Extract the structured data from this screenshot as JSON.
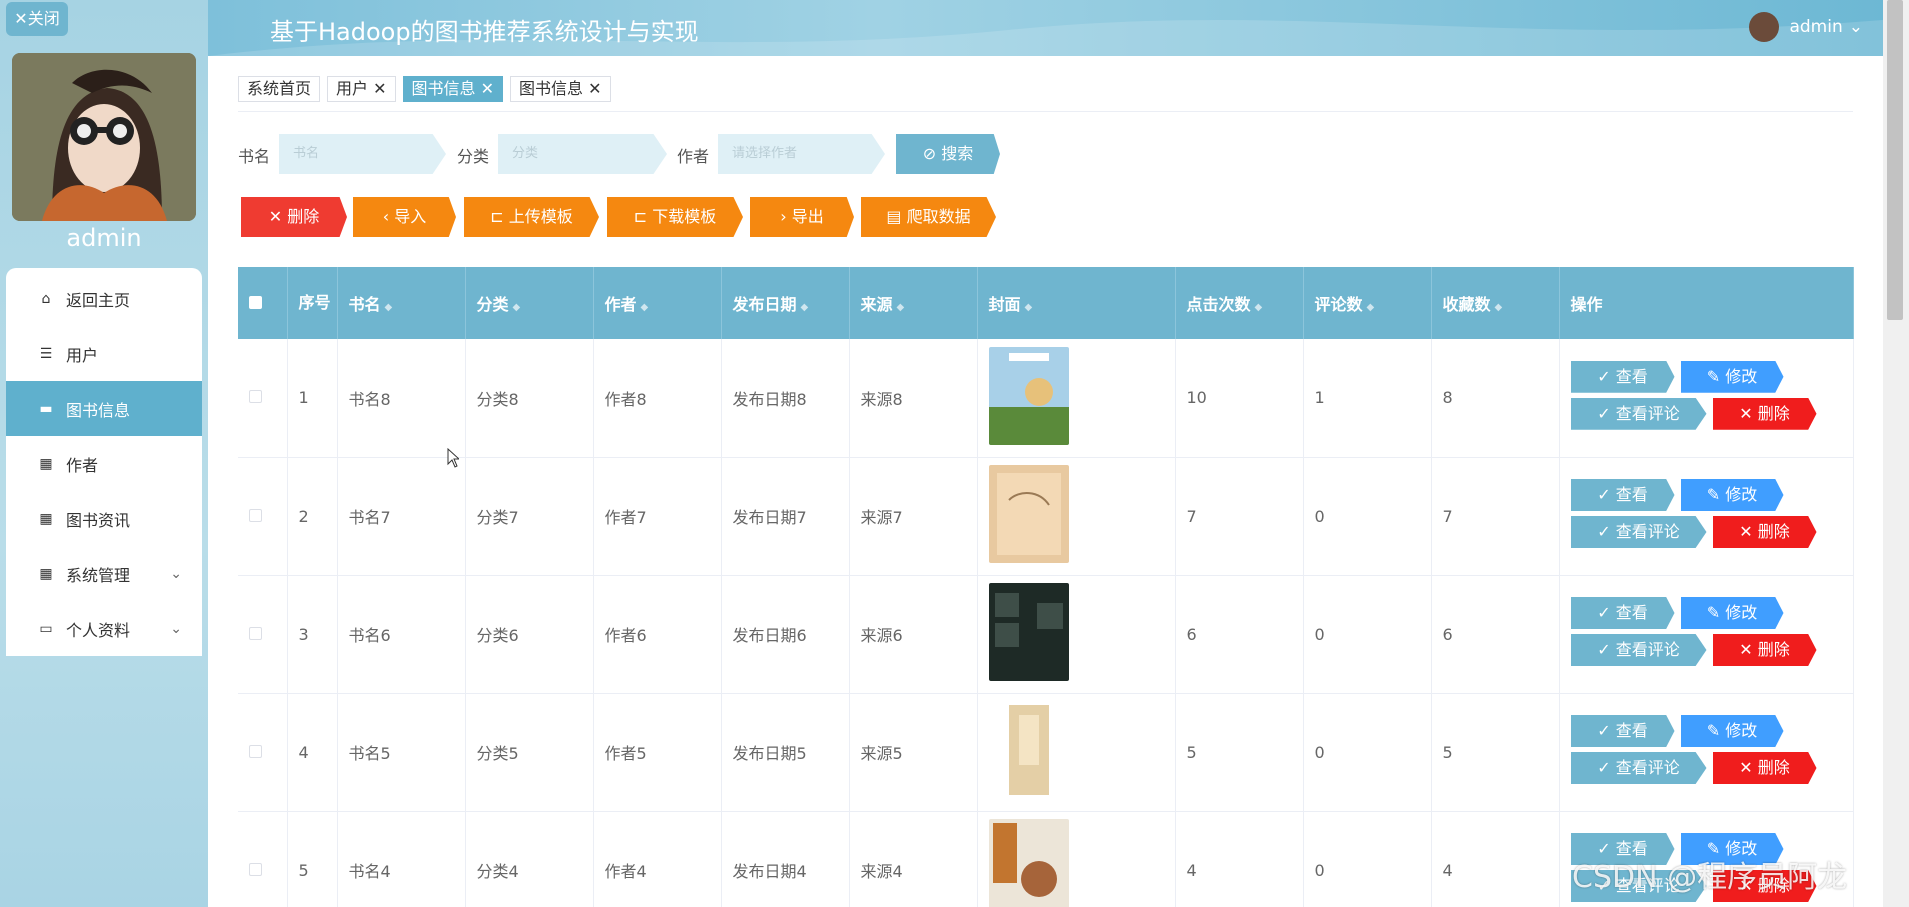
{
  "sidebar": {
    "close_label": "✕关闭",
    "admin_name": "admin",
    "menu": [
      {
        "label": "返回主页",
        "icon": "home-icon"
      },
      {
        "label": "用户",
        "icon": "sliders-icon"
      },
      {
        "label": "图书信息",
        "icon": "monitor-icon",
        "active": true
      },
      {
        "label": "作者",
        "icon": "grid-icon"
      },
      {
        "label": "图书资讯",
        "icon": "grid-icon"
      },
      {
        "label": "系统管理",
        "icon": "grid-icon",
        "expandable": true
      },
      {
        "label": "个人资料",
        "icon": "card-icon",
        "expandable": true
      }
    ]
  },
  "header": {
    "title": "基于Hadoop的图书推荐系统设计与实现",
    "user": "admin",
    "user_chevron": "⌄"
  },
  "tabs": [
    {
      "label": "系统首页",
      "closable": false
    },
    {
      "label": "用户 ✕",
      "closable": true
    },
    {
      "label": "图书信息 ✕",
      "closable": true,
      "active": true
    },
    {
      "label": "图书信息 ✕",
      "closable": true
    }
  ],
  "search": {
    "name_label": "书名",
    "name_placeholder": "书名",
    "category_label": "分类",
    "category_placeholder": "分类",
    "author_label": "作者",
    "author_placeholder": "请选择作者",
    "button": "⊘ 搜索"
  },
  "actions": [
    {
      "label": "✕ 删除",
      "color": "#ef3b31"
    },
    {
      "label": "‹ 导入",
      "color": "#f58810"
    },
    {
      "label": "⊏ 上传模板",
      "color": "#f58810"
    },
    {
      "label": "⊏ 下载模板",
      "color": "#f58810"
    },
    {
      "label": "› 导出",
      "color": "#f58810"
    },
    {
      "label": "▤ 爬取数据",
      "color": "#f58810"
    }
  ],
  "table": {
    "columns": [
      "序号",
      "书名",
      "分类",
      "作者",
      "发布日期",
      "来源",
      "封面",
      "点击次数",
      "评论数",
      "收藏数",
      "操作"
    ],
    "rows": [
      {
        "idx": "1",
        "name": "书名8",
        "category": "分类8",
        "author": "作者8",
        "date": "发布日期8",
        "source": "来源8",
        "clicks": "10",
        "comments": "1",
        "favorites": "8"
      },
      {
        "idx": "2",
        "name": "书名7",
        "category": "分类7",
        "author": "作者7",
        "date": "发布日期7",
        "source": "来源7",
        "clicks": "7",
        "comments": "0",
        "favorites": "7"
      },
      {
        "idx": "3",
        "name": "书名6",
        "category": "分类6",
        "author": "作者6",
        "date": "发布日期6",
        "source": "来源6",
        "clicks": "6",
        "comments": "0",
        "favorites": "6"
      },
      {
        "idx": "4",
        "name": "书名5",
        "category": "分类5",
        "author": "作者5",
        "date": "发布日期5",
        "source": "来源5",
        "clicks": "5",
        "comments": "0",
        "favorites": "5"
      },
      {
        "idx": "5",
        "name": "书名4",
        "category": "分类4",
        "author": "作者4",
        "date": "发布日期4",
        "source": "来源4",
        "clicks": "4",
        "comments": "0",
        "favorites": "4"
      }
    ],
    "ops": {
      "view": "✓ 查看",
      "edit": "✎ 修改",
      "comment": "✓ 查看评论",
      "delete": "✕ 删除"
    }
  },
  "watermark": "CSDN @程序员阿龙",
  "colors": {
    "accent": "#6fb5cf",
    "danger": "#ef3b31",
    "warning": "#f58810",
    "primary": "#409eff"
  }
}
